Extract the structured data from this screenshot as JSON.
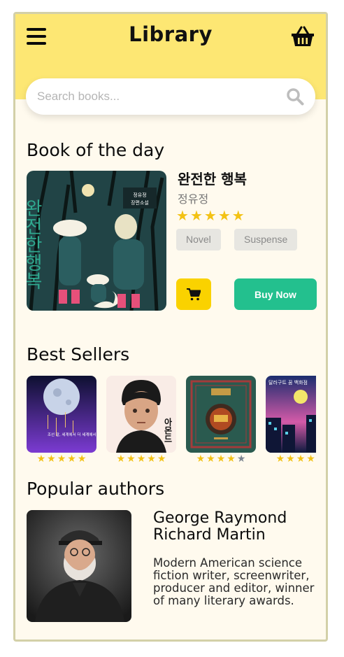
{
  "header": {
    "title": "Library",
    "menu_icon": "menu-icon",
    "cart_icon": "basket-icon",
    "background": "#fde773"
  },
  "search": {
    "placeholder": "Search books...",
    "value": "",
    "icon": "search-icon"
  },
  "book_of_the_day": {
    "section_title": "Book of the day",
    "title": "완전한 행복",
    "author": "정유정",
    "cover_text": {
      "title_vertical": "완전한행복",
      "badge_line1": "정유정",
      "badge_line2": "장편소설"
    },
    "rating": 5,
    "tags": [
      "Novel",
      "Suspense"
    ],
    "cart_icon": "cart-icon",
    "buy_label": "Buy Now",
    "accent_colors": {
      "cart": "#fad200",
      "buy": "#23c08e"
    }
  },
  "best_sellers": {
    "section_title": "Best Sellers",
    "items": [
      {
        "rating": 5,
        "cover_text": "조선 말, 세계에서 더 세계에서 세계에서 세상"
      },
      {
        "rating": 5,
        "cover_text": "아몬드"
      },
      {
        "rating": 4,
        "cover_text": ""
      },
      {
        "rating": 5,
        "cover_text": "달러구트 꿈 백화점"
      }
    ]
  },
  "popular_authors": {
    "section_title": "Popular authors",
    "name": "George Raymond Richard Martin",
    "bio": "Modern American science fiction writer, screenwriter, producer and editor, winner of many literary awards."
  }
}
